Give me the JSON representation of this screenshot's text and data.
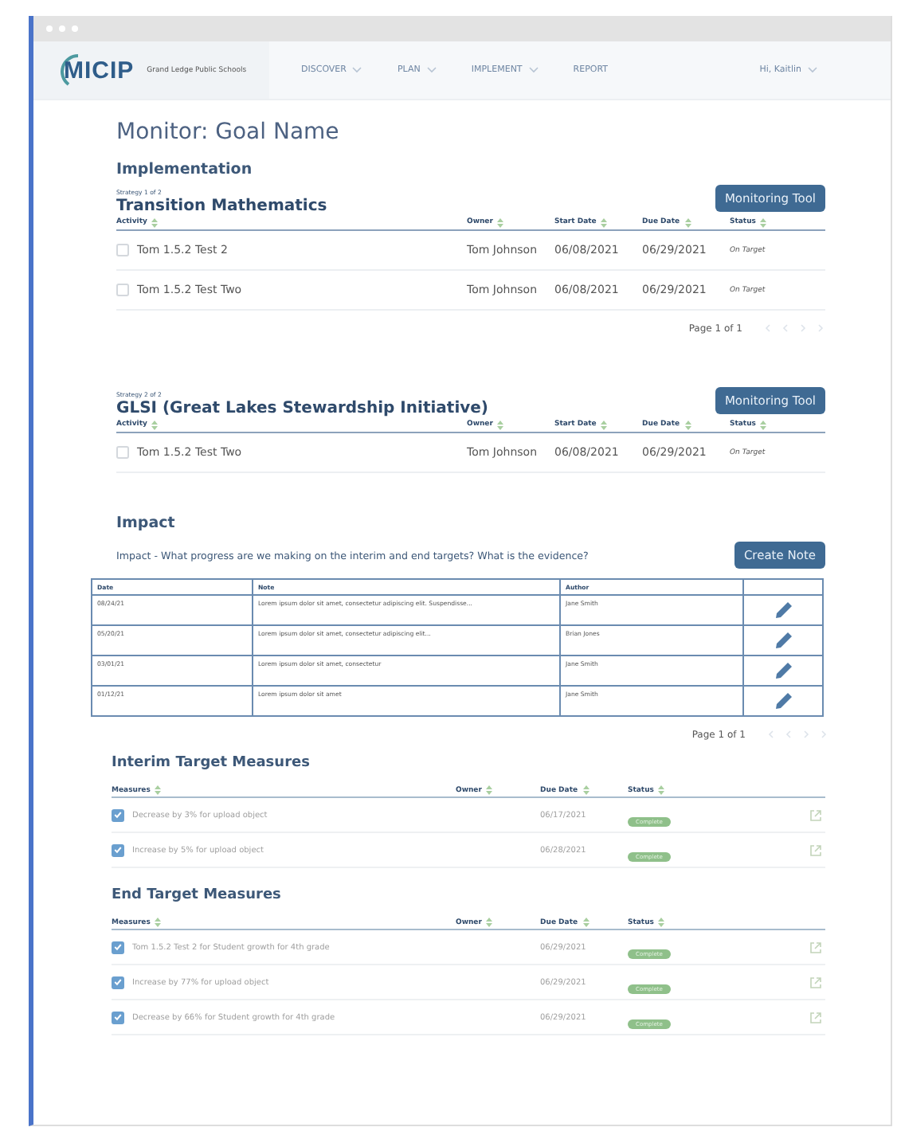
{
  "header": {
    "logo": "MICIP",
    "district": "Grand Ledge Public Schools",
    "nav": [
      {
        "label": "DISCOVER",
        "has_menu": true
      },
      {
        "label": "PLAN",
        "has_menu": true
      },
      {
        "label": "IMPLEMENT",
        "has_menu": true
      },
      {
        "label": "REPORT",
        "has_menu": false
      }
    ],
    "user": {
      "label": "Hi, Kaitlin",
      "has_menu": true
    }
  },
  "page_title": "Monitor: Goal Name",
  "implementation": {
    "title": "Implementation",
    "strategies": [
      {
        "counter": "Strategy 1 of 2",
        "name": "Transition Mathematics",
        "button": "Monitoring Tool",
        "columns": [
          "Activity",
          "Owner",
          "Start Date",
          "Due Date",
          "Status"
        ],
        "pagination": "Page 1 of 1",
        "rows": [
          {
            "activity": "Tom 1.5.2 Test 2",
            "owner": "Tom Johnson",
            "start_date": "06/08/2021",
            "due_date": "06/29/2021",
            "status": "On Target",
            "checked": false
          },
          {
            "activity": "Tom 1.5.2 Test Two",
            "owner": "Tom Johnson",
            "start_date": "06/08/2021",
            "due_date": "06/29/2021",
            "status": "On Target",
            "checked": false
          }
        ]
      },
      {
        "counter": "Strategy 2 of 2",
        "name": "GLSI (Great Lakes Stewardship Initiative)",
        "button": "Monitoring Tool",
        "columns": [
          "Activity",
          "Owner",
          "Start Date",
          "Due Date",
          "Status"
        ],
        "rows": [
          {
            "activity": "Tom 1.5.2 Test Two",
            "owner": "Tom Johnson",
            "start_date": "06/08/2021",
            "due_date": "06/29/2021",
            "status": "On Target",
            "checked": false
          }
        ]
      }
    ]
  },
  "impact": {
    "title": "Impact",
    "question": "Impact - What progress are we making on the interim and end targets? What is the evidence?",
    "button": "Create Note",
    "columns": [
      "Date",
      "Note",
      "Author"
    ],
    "pagination": "Page 1 of 1",
    "rows": [
      {
        "date": "08/24/21",
        "note": "Lorem ipsum dolor sit amet, consectetur adipiscing elit. Suspendisse...",
        "author": "Jane Smith"
      },
      {
        "date": "05/20/21",
        "note": "Lorem ipsum dolor sit amet, consectetur adipiscing elit...",
        "author": "Brian Jones"
      },
      {
        "date": "03/01/21",
        "note": "Lorem ipsum dolor sit amet, consectetur",
        "author": "Jane Smith"
      },
      {
        "date": "01/12/21",
        "note": "Lorem ipsum dolor sit amet",
        "author": "Jane Smith"
      }
    ]
  },
  "measures": [
    {
      "title": "Interim Target Measures",
      "columns": [
        "Measures",
        "Owner",
        "Due Date",
        "Status"
      ],
      "rows": [
        {
          "measure": "Decrease by 3% for upload object",
          "due_date": "06/17/2021",
          "status": "Complete",
          "checked": true
        },
        {
          "measure": "Increase by 5% for upload object",
          "due_date": "06/28/2021",
          "status": "Complete",
          "checked": true
        }
      ]
    },
    {
      "title": "End Target Measures",
      "columns": [
        "Measures",
        "Owner",
        "Due Date",
        "Status"
      ],
      "rows": [
        {
          "measure": "Tom 1.5.2 Test 2 for Student growth for 4th grade",
          "due_date": "06/29/2021",
          "status": "Complete",
          "checked": true
        },
        {
          "measure": "Increase by 77% for upload object",
          "due_date": "06/29/2021",
          "status": "Complete",
          "checked": true
        },
        {
          "measure": "Decrease by 66% for Student growth for 4th grade",
          "due_date": "06/29/2021",
          "status": "Complete",
          "checked": true
        }
      ]
    }
  ]
}
